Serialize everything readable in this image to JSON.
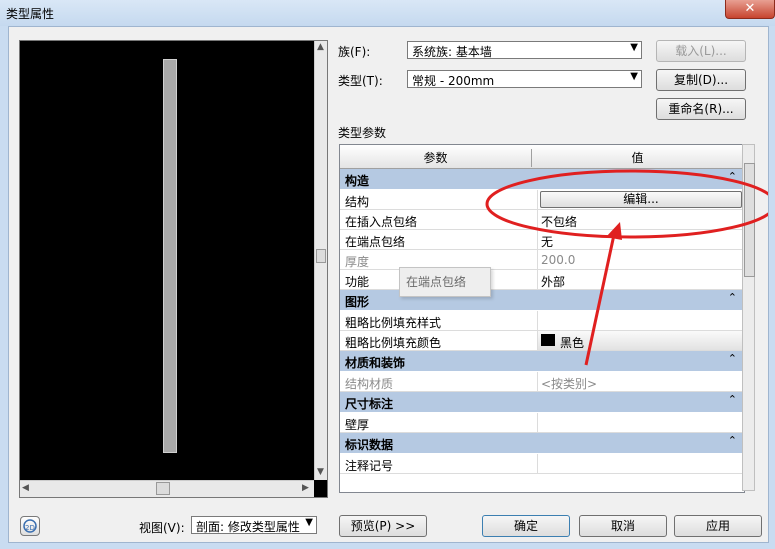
{
  "window": {
    "title": "类型属性",
    "close_glyph": "✕"
  },
  "preview": {
    "scroll_up": "▲",
    "scroll_down": "▼",
    "scroll_left": "◀",
    "scroll_right": "▶"
  },
  "family": {
    "label": "族(F):",
    "value": "系统族: 基本墙"
  },
  "type": {
    "label": "类型(T):",
    "value": "常规 - 200mm"
  },
  "buttons": {
    "load": "载入(L)...",
    "duplicate": "复制(D)...",
    "rename": "重命名(R)..."
  },
  "params_title": "类型参数",
  "grid": {
    "col_param": "参数",
    "col_value": "值",
    "collapse_glyph": "⌃",
    "groups": [
      {
        "title": "构造",
        "rows": [
          {
            "param": "结构",
            "value": "编辑...",
            "kind": "button"
          },
          {
            "param": "在插入点包络",
            "value": "不包络"
          },
          {
            "param": "在端点包络",
            "value": "无"
          },
          {
            "param": "厚度",
            "value": "200.0",
            "grey": true
          },
          {
            "param": "功能",
            "value": "外部"
          }
        ]
      },
      {
        "title": "图形",
        "rows": [
          {
            "param": "粗略比例填充样式",
            "value": ""
          },
          {
            "param": "粗略比例填充颜色",
            "value": "黑色",
            "kind": "color",
            "color": "#000000"
          }
        ]
      },
      {
        "title": "材质和装饰",
        "rows": [
          {
            "param": "结构材质",
            "value": "<按类别>",
            "grey": true
          }
        ]
      },
      {
        "title": "尺寸标注",
        "rows": [
          {
            "param": "壁厚",
            "value": ""
          }
        ]
      },
      {
        "title": "标识数据",
        "rows": [
          {
            "param": "注释记号",
            "value": ""
          }
        ]
      }
    ]
  },
  "tooltip": "在端点包络",
  "annotation": {
    "color": "#e02020"
  },
  "footer": {
    "view_label": "视图(V):",
    "view_value": "剖面: 修改类型属性",
    "preview_btn": "预览(P) >>",
    "ok": "确定",
    "cancel": "取消",
    "apply": "应用"
  }
}
